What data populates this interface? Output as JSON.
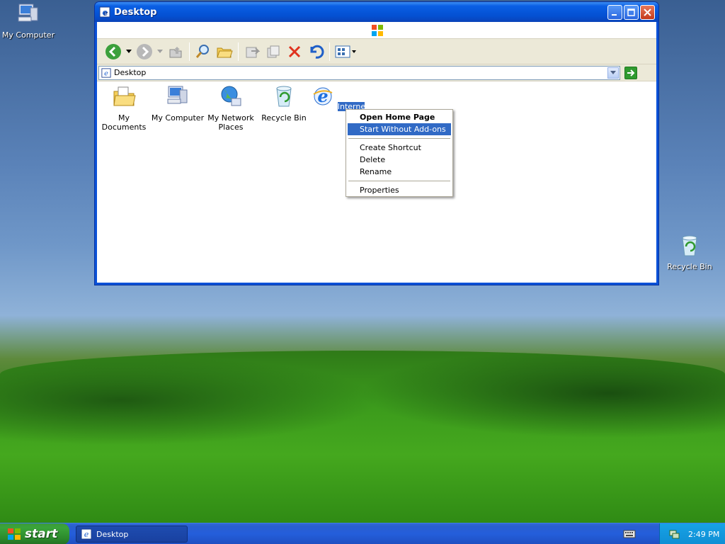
{
  "desktop": {
    "icons": [
      {
        "label": "My Computer",
        "icon": "my-computer-icon"
      },
      {
        "label": "Recycle Bin",
        "icon": "recycle-bin-icon"
      }
    ]
  },
  "window": {
    "title": "Desktop",
    "address": "Desktop",
    "items": [
      {
        "label": "My Documents",
        "icon": "my-documents-icon"
      },
      {
        "label": "My Computer",
        "icon": "my-computer-icon"
      },
      {
        "label": "My Network Places",
        "icon": "network-places-icon"
      },
      {
        "label": "Recycle Bin",
        "icon": "recycle-bin-icon"
      },
      {
        "label": "Internet Explorer",
        "icon": "internet-explorer-icon"
      }
    ]
  },
  "context_menu": {
    "items": [
      "Open Home Page",
      "Start Without Add-ons",
      "Create Shortcut",
      "Delete",
      "Rename",
      "Properties"
    ],
    "highlighted": "Start Without Add-ons"
  },
  "taskbar": {
    "start_label": "start",
    "task_label": "Desktop",
    "clock": "2:49 PM"
  },
  "colors": {
    "titlebar": "#0a5fe4",
    "selection": "#316ac5",
    "start_button": "#3aa53a"
  }
}
